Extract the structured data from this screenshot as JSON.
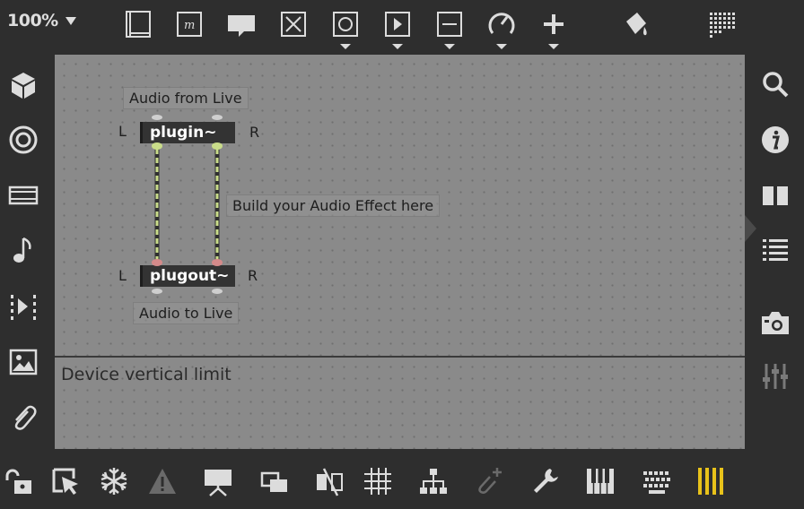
{
  "toolbar": {
    "zoom_label": "100%",
    "top_icons": [
      "presentation-mode-icon",
      "message-object-icon",
      "comment-icon",
      "toggle-icon",
      "button-icon",
      "play-icon",
      "number-box-icon",
      "dial-icon",
      "add-object-icon",
      "paint-bucket-icon",
      "grid-mode-icon"
    ]
  },
  "left_sidebar": {
    "icons": [
      "object-box-icon",
      "target-icon",
      "device-icon",
      "music-note-icon",
      "step-forward-icon",
      "image-icon",
      "paperclip-icon"
    ]
  },
  "right_sidebar": {
    "icons": [
      "search-icon",
      "info-icon",
      "book-icon",
      "list-icon",
      "camera-icon",
      "mixer-icon"
    ]
  },
  "bottom_toolbar": {
    "icons": [
      "lock-icon",
      "select-cursor-icon",
      "freeze-icon",
      "warning-icon",
      "presentation-icon",
      "layer-icon",
      "visibility-toggle-icon",
      "grid-icon",
      "hierarchy-icon",
      "add-attachment-icon",
      "wrench-icon",
      "piano-icon",
      "keyboard-icon",
      "level-meter-icon"
    ]
  },
  "patch": {
    "comment_audio_from": "Audio from Live",
    "plugin_label": "plugin~",
    "plugin_left": "L",
    "plugin_right": "R",
    "comment_build": "Build your Audio Effect here",
    "plugout_label": "plugout~",
    "plugout_left": "L",
    "plugout_right": "R",
    "comment_audio_to": "Audio to Live",
    "vertical_limit_label": "Device vertical limit"
  },
  "colors": {
    "background": "#2e2e2e",
    "canvas": "#8a8a8a",
    "object_fill": "#333333",
    "cable": "#c9dc8a",
    "meter_accent": "#e8c21a"
  }
}
